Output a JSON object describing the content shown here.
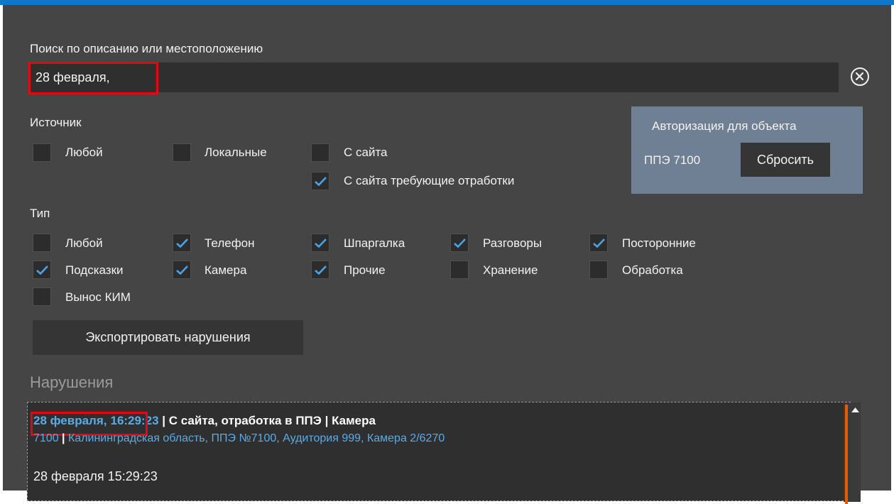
{
  "search": {
    "label": "Поиск по описанию или местоположению",
    "value": "28 февраля,"
  },
  "source": {
    "title": "Источник",
    "options": [
      {
        "label": "Любой",
        "checked": false
      },
      {
        "label": "Локальные",
        "checked": false
      },
      {
        "label": "С сайта",
        "checked": false
      },
      {
        "label": "С сайта требующие отработки",
        "checked": true
      }
    ]
  },
  "auth": {
    "title": "Авторизация для объекта",
    "object": "ППЭ 7100",
    "reset_label": "Сбросить"
  },
  "type": {
    "title": "Тип",
    "options": [
      {
        "label": "Любой",
        "checked": false
      },
      {
        "label": "Телефон",
        "checked": true
      },
      {
        "label": "Шпаргалка",
        "checked": true
      },
      {
        "label": "Разговоры",
        "checked": true
      },
      {
        "label": "Посторонние",
        "checked": true
      },
      {
        "label": "Подсказки",
        "checked": true
      },
      {
        "label": "Камера",
        "checked": true
      },
      {
        "label": "Прочие",
        "checked": true
      },
      {
        "label": "Хранение",
        "checked": false
      },
      {
        "label": "Обработка",
        "checked": false
      },
      {
        "label": "Вынос КИМ",
        "checked": false
      }
    ]
  },
  "export_label": "Экспортировать нарушения",
  "violations": {
    "title": "Нарушения",
    "items": [
      {
        "date": "28 февраля,",
        "time": "16:29:23",
        "separator": " | ",
        "source": "С сайта, отработка в ППЭ",
        "type": "Камера",
        "code": "7100",
        "location": "Калининградская область, ППЭ №7100, Аудитория 999, Камера  2/6270",
        "description": "28 февраля 15:29:23"
      }
    ]
  },
  "colors": {
    "accent": "#0a79d1",
    "panel": "#454545",
    "highlight": "#e30613",
    "link": "#5aabe6",
    "scroll_accent": "#e85a00",
    "auth_box": "#6f8094"
  }
}
